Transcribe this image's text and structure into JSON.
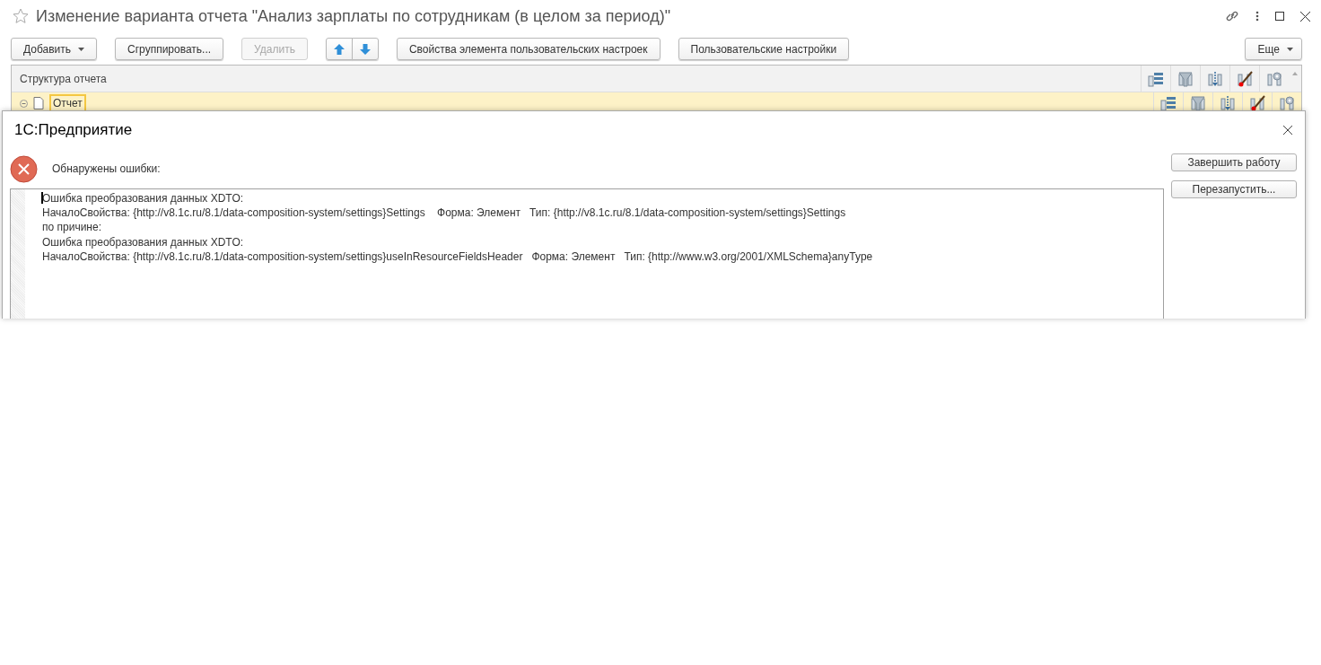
{
  "window": {
    "title": "Изменение варианта отчета \"Анализ зарплаты по сотрудникам (в целом за период)\"",
    "favorite": false
  },
  "toolbar": {
    "buttons": [
      {
        "kind": "dropdown",
        "label": "Добавить",
        "disabled": false
      },
      {
        "kind": "plain",
        "label": "Сгруппировать...",
        "disabled": false
      },
      {
        "kind": "plain",
        "label": "Удалить",
        "disabled": true
      },
      {
        "kind": "move_up"
      },
      {
        "kind": "move_down"
      },
      {
        "kind": "plain",
        "label": "Свойства элемента пользовательских настроек",
        "disabled": false
      },
      {
        "kind": "plain",
        "label": "Пользовательские настройки",
        "disabled": false
      }
    ],
    "more": "Еще"
  },
  "tree": {
    "column": "Структура отчета",
    "column_icons": [
      {
        "kind": "fields"
      },
      {
        "kind": "filter"
      },
      {
        "kind": "order"
      },
      {
        "kind": "appearance"
      },
      {
        "kind": "settings"
      }
    ],
    "rows": [
      {
        "label": "Отчет",
        "expanded": true,
        "selected": true
      }
    ]
  },
  "dialog": {
    "title": "1С:Предприятие",
    "message": "Обнаружены ошибки:",
    "details": [
      "Ошибка преобразования данных XDTO:",
      "НачалоСвойства: {http://v8.1c.ru/8.1/data-composition-system/settings}Settings    Форма: Элемент   Тип: {http://v8.1c.ru/8.1/data-composition-system/settings}Settings",
      "по причине:",
      "Ошибка преобразования данных XDTO:",
      "НачалоСвойства: {http://v8.1c.ru/8.1/data-composition-system/settings}useInResourceFieldsHeader   Форма: Элемент   Тип: {http://www.w3.org/2001/XMLSchema}anyType"
    ],
    "buttons": [
      "Завершить работу",
      "Перезапустить..."
    ]
  }
}
